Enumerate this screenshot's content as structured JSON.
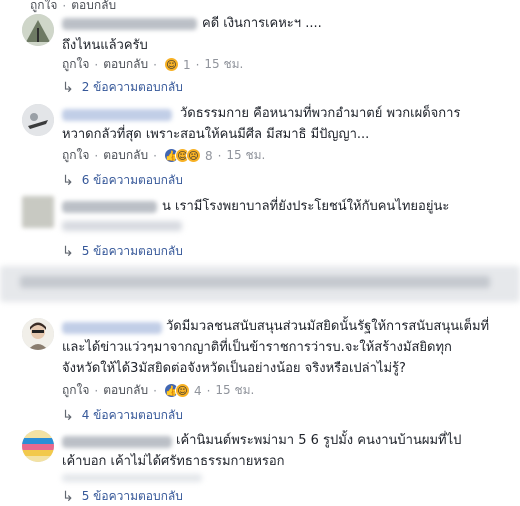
{
  "top_bar": {
    "like": "ถูกใจ",
    "reply": "ตอบกลับ"
  },
  "comments": [
    {
      "text_lines": [
        "คดี เงินการเคหะฯ ....",
        "ถึงไหนแล้วครับ"
      ],
      "like": "ถูกใจ",
      "reply": "ตอบกลับ",
      "reaction_count": "1",
      "time": "15 ชม.",
      "replies": "2 ข้อความตอบกลับ"
    },
    {
      "text_lines": [
        "วัดธรรมกาย คือหนามที่พวกอำมาตย์ พวกเผด็จการ",
        "หวาดกลัวที่สุด เพราะสอนให้คนมีศีล มีสมาธิ มีปัญญา..."
      ],
      "like": "ถูกใจ",
      "reply": "ตอบกลับ",
      "reaction_count": "8",
      "time": "15 ชม.",
      "replies": "6 ข้อความตอบกลับ"
    },
    {
      "text_lines": [
        "น เรามีโรงพยาบาลที่ยังประโยชน์ให้กับคนไทยอยู่นะ"
      ],
      "replies": "5 ข้อความตอบกลับ"
    },
    {
      "text_lines": [
        "วัดมีมวลชนสนับสนุนส่วนมัสยิดนั้นรัฐให้การสนับสนุนเต็มที่",
        "และได้ข่าวแว่วๆมาจากญาติที่เป็นข้าราชการว่ารบ.จะให้สร้างมัสยิดทุก",
        "จังหวัดให้ได้3มัสยิดต่อจังหวัดเป็นอย่างน้อย จริงหรือเปล่าไม่รู้?"
      ],
      "like": "ถูกใจ",
      "reply": "ตอบกลับ",
      "reaction_count": "4",
      "time": "15 ชม.",
      "replies": "4 ข้อความตอบกลับ"
    },
    {
      "text_lines": [
        "เค้านิมนต์พระพม่ามา 5 6 รูปมั้ง คนงานบ้านผมที่ไป",
        "เค้าบอก เค้าไม่ได้ศรัทธาธรรมกายหรอก"
      ],
      "replies": "5 ข้อความตอบกลับ"
    }
  ],
  "colors": {
    "link": "#365899",
    "meta": "#90949c",
    "text": "#1d2129",
    "like": "#4267b2",
    "haha": "#f7b125"
  }
}
